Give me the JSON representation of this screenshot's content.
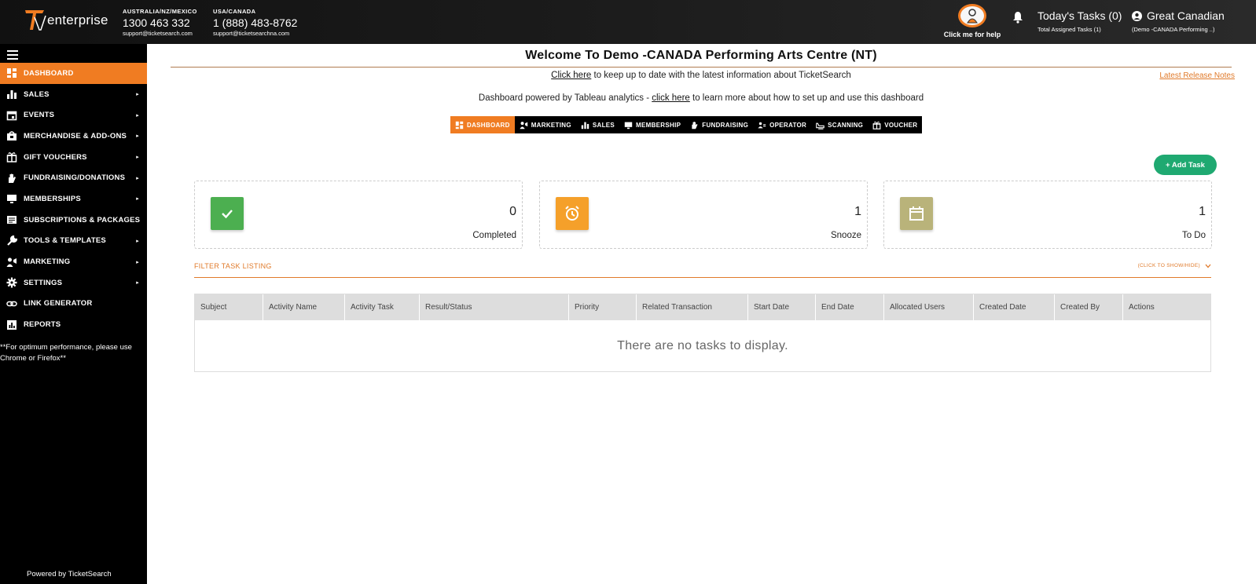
{
  "header": {
    "logo_text": "enterprise",
    "contacts": [
      {
        "region": "AUSTRALIA/NZ/MEXICO",
        "phone": "1300 463 332",
        "email": "support@ticketsearch.com"
      },
      {
        "region": "USA/CANADA",
        "phone": "1 (888) 483-8762",
        "email": "support@ticketsearchna.com"
      }
    ],
    "help_label": "Click me for help",
    "tasks_title": "Today's Tasks (0)",
    "tasks_sub": "Total Assigned Tasks (1)",
    "user_name": "Great Canadian",
    "user_sub": "(Demo -CANADA Performing ..)"
  },
  "sidebar": {
    "items": [
      {
        "label": "DASHBOARD",
        "icon": "dashboard-icon",
        "active": true,
        "caret": false
      },
      {
        "label": "SALES",
        "icon": "bar-chart-icon",
        "active": false,
        "caret": true
      },
      {
        "label": "EVENTS",
        "icon": "calendar-icon",
        "active": false,
        "caret": true
      },
      {
        "label": "MERCHANDISE & ADD-ONS",
        "icon": "bag-icon",
        "active": false,
        "caret": true
      },
      {
        "label": "GIFT VOUCHERS",
        "icon": "gift-icon",
        "active": false,
        "caret": true
      },
      {
        "label": "FUNDRAISING/DONATIONS",
        "icon": "hand-icon",
        "active": false,
        "caret": true
      },
      {
        "label": "MEMBERSHIPS",
        "icon": "monitor-icon",
        "active": false,
        "caret": true
      },
      {
        "label": "SUBSCRIPTIONS & PACKAGES",
        "icon": "list-icon",
        "active": false,
        "caret": false
      },
      {
        "label": "TOOLS & TEMPLATES",
        "icon": "wrench-icon",
        "active": false,
        "caret": true
      },
      {
        "label": "MARKETING",
        "icon": "megaphone-icon",
        "active": false,
        "caret": true
      },
      {
        "label": "SETTINGS",
        "icon": "gear-icon",
        "active": false,
        "caret": true
      },
      {
        "label": "LINK GENERATOR",
        "icon": "link-icon",
        "active": false,
        "caret": false
      },
      {
        "label": "REPORTS",
        "icon": "report-icon",
        "active": false,
        "caret": false
      }
    ],
    "perf_note": "**For optimum performance, please use Chrome or Firefox**",
    "powered_by": "Powered by TicketSearch"
  },
  "main": {
    "welcome": "Welcome To Demo -CANADA Performing Arts Centre (NT)",
    "info1_link": "Click here",
    "info1_text": " to keep up to date with the latest information about TicketSearch",
    "release_notes": "Latest Release Notes",
    "info2_pre": "Dashboard powered by Tableau analytics - ",
    "info2_link": "click here",
    "info2_post": " to learn more about how to set up and use this dashboard",
    "tabs": [
      {
        "label": "DASHBOARD",
        "icon": "dashboard-icon",
        "active": true
      },
      {
        "label": "MARKETING",
        "icon": "megaphone-icon",
        "active": false
      },
      {
        "label": "SALES",
        "icon": "bar-chart-icon",
        "active": false
      },
      {
        "label": "MEMBERSHIP",
        "icon": "monitor-icon",
        "active": false
      },
      {
        "label": "FUNDRAISING",
        "icon": "hand-icon",
        "active": false
      },
      {
        "label": "OPERATOR",
        "icon": "people-icon",
        "active": false
      },
      {
        "label": "SCANNING",
        "icon": "scanner-icon",
        "active": false
      },
      {
        "label": "VOUCHER",
        "icon": "gift-icon",
        "active": false
      }
    ],
    "add_task": "+ Add Task",
    "cards": [
      {
        "value": "0",
        "label": "Completed",
        "color": "#4caf50",
        "icon": "check-icon"
      },
      {
        "value": "1",
        "label": "Snooze",
        "color": "#f5a02a",
        "icon": "alarm-clock-icon"
      },
      {
        "value": "1",
        "label": "To Do",
        "color": "#b9b37a",
        "icon": "calendar-icon"
      }
    ],
    "filter_label": "FILTER TASK LISTING",
    "filter_toggle": "(CLICK TO SHOW/HIDE)",
    "table": {
      "columns": [
        "Subject",
        "Activity Name",
        "Activity Task",
        "Result/Status",
        "Priority",
        "Related Transaction",
        "Start Date",
        "End Date",
        "Allocated Users",
        "Created Date",
        "Created By",
        "Actions"
      ],
      "empty_text": "There are no tasks to display."
    }
  },
  "colors": {
    "accent": "#f07c22",
    "green": "#1fa971"
  }
}
